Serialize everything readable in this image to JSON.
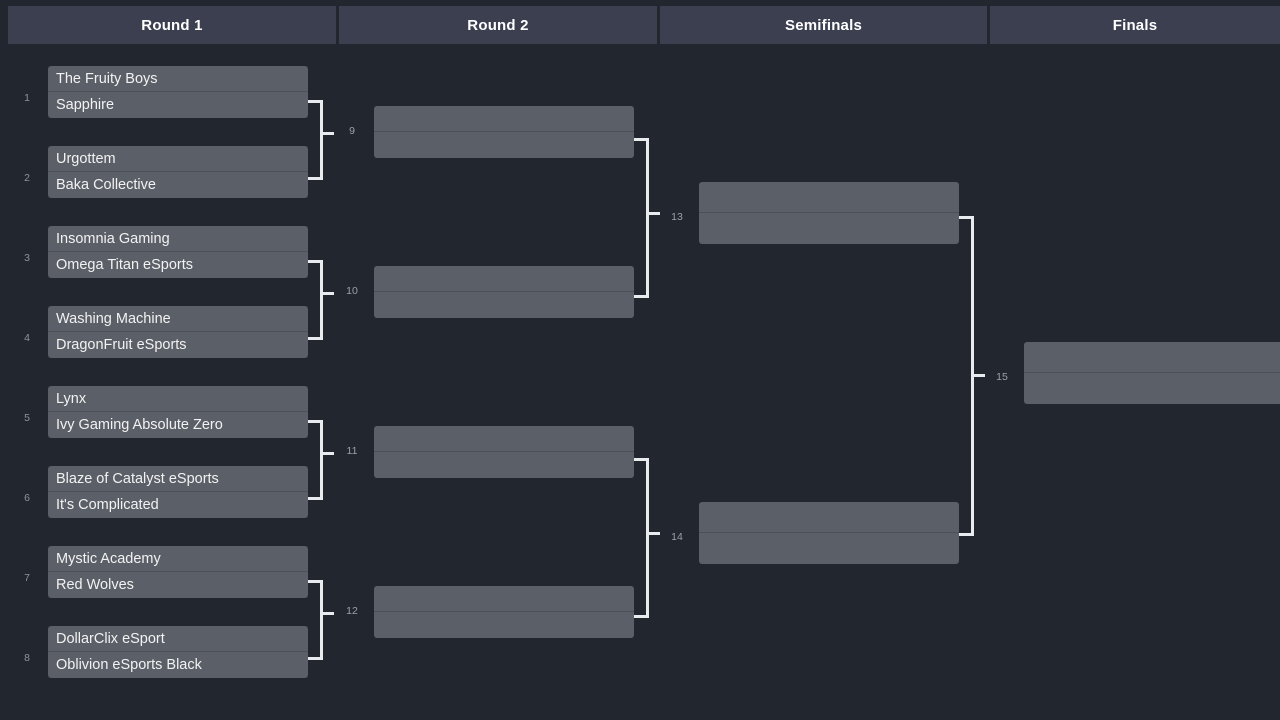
{
  "header": {
    "columns": [
      {
        "label": "Round 1"
      },
      {
        "label": "Round 2"
      },
      {
        "label": "Semifinals"
      },
      {
        "label": "Finals"
      }
    ]
  },
  "bracket": {
    "round1": {
      "matches": [
        {
          "number": "1",
          "teams": [
            "The Fruity Boys",
            "Sapphire"
          ]
        },
        {
          "number": "2",
          "teams": [
            "Urgottem",
            "Baka Collective"
          ]
        },
        {
          "number": "3",
          "teams": [
            "Insomnia Gaming",
            "Omega Titan eSports"
          ]
        },
        {
          "number": "4",
          "teams": [
            "Washing Machine",
            "DragonFruit eSports"
          ]
        },
        {
          "number": "5",
          "teams": [
            "Lynx",
            "Ivy Gaming Absolute Zero"
          ]
        },
        {
          "number": "6",
          "teams": [
            "Blaze of Catalyst eSports",
            "It's Complicated"
          ]
        },
        {
          "number": "7",
          "teams": [
            "Mystic Academy",
            "Red Wolves"
          ]
        },
        {
          "number": "8",
          "teams": [
            "DollarClix eSport",
            "Oblivion eSports Black"
          ]
        }
      ]
    },
    "round2": {
      "matches": [
        {
          "number": "9",
          "teams": [
            "",
            ""
          ]
        },
        {
          "number": "10",
          "teams": [
            "",
            ""
          ]
        },
        {
          "number": "11",
          "teams": [
            "",
            ""
          ]
        },
        {
          "number": "12",
          "teams": [
            "",
            ""
          ]
        }
      ]
    },
    "semifinals": {
      "matches": [
        {
          "number": "13",
          "teams": [
            "",
            ""
          ]
        },
        {
          "number": "14",
          "teams": [
            "",
            ""
          ]
        }
      ]
    },
    "finals": {
      "matches": [
        {
          "number": "15",
          "teams": [
            "",
            ""
          ]
        }
      ]
    }
  },
  "colors": {
    "page_background": "#22262f",
    "header_background": "#3b3f50",
    "match_background": "#5b5f67",
    "connector": "#e9ecef",
    "team_text": "#f2f2f2",
    "seed_text": "#8e939c",
    "match_number_text": "#9aa0a9"
  }
}
